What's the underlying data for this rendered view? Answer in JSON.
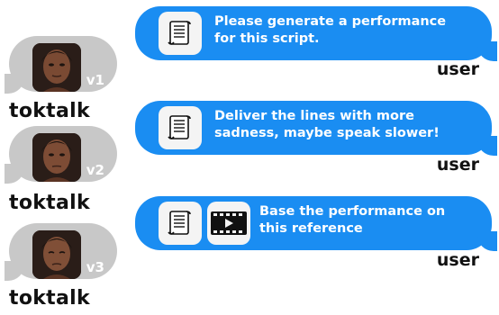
{
  "bot_messages": [
    {
      "version": "v1",
      "name": "toktalk"
    },
    {
      "version": "v2",
      "name": "toktalk"
    },
    {
      "version": "v3",
      "name": "toktalk"
    }
  ],
  "user_messages": [
    {
      "text": "Please generate a performance for this script.",
      "icons": [
        "script-scroll-icon"
      ],
      "sender": "user"
    },
    {
      "text": "Deliver the lines with more sadness, maybe speak slower!",
      "icons": [
        "script-scroll-icon"
      ],
      "sender": "user"
    },
    {
      "text": "Base the performance on this reference",
      "icons": [
        "script-scroll-icon",
        "video-reference-icon"
      ],
      "sender": "user"
    }
  ],
  "colors": {
    "user_bubble": "#1a8df2",
    "bot_bubble": "#c8c8c8",
    "text_dark": "#111111"
  }
}
